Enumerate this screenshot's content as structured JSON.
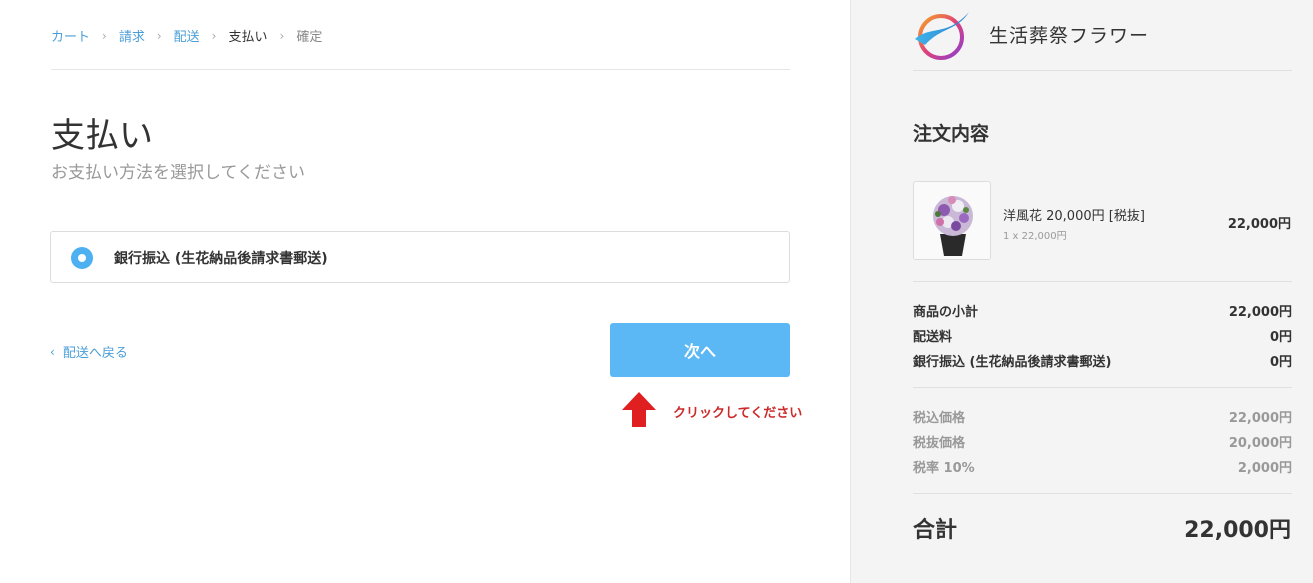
{
  "breadcrumb": {
    "cart": "カート",
    "billing": "請求",
    "shipping": "配送",
    "payment": "支払い",
    "confirm": "確定",
    "separator": "›"
  },
  "main": {
    "title": "支払い",
    "subtitle": "お支払い方法を選択してください",
    "payment_method": "銀行振込 (生花納品後請求書郵送)",
    "back_link": "配送へ戻る",
    "back_chevron": "‹",
    "next_button": "次へ",
    "click_note": "クリックしてください"
  },
  "sidebar": {
    "shop_name": "生活葬祭フラワー",
    "order_title": "注文内容",
    "product": {
      "name": "洋風花 20,000円 [税抜]",
      "qty": "1 x 22,000円",
      "price": "22,000円"
    },
    "summary": [
      {
        "label": "商品の小計",
        "value": "22,000円"
      },
      {
        "label": "配送料",
        "value": "0円"
      },
      {
        "label": "銀行振込 (生花納品後請求書郵送)",
        "value": "0円"
      }
    ],
    "tax": [
      {
        "label": "税込価格",
        "value": "22,000円"
      },
      {
        "label": "税抜価格",
        "value": "20,000円"
      },
      {
        "label": "税率 10%",
        "value": "2,000円"
      }
    ],
    "total_label": "合計",
    "total_value": "22,000円"
  },
  "colors": {
    "accent": "#5bb8f5",
    "link": "#4a9ed6",
    "warning": "#e02020"
  },
  "icons": [
    "radio-selected-icon",
    "arrow-up-icon",
    "logo-icon",
    "flower-product-image"
  ]
}
